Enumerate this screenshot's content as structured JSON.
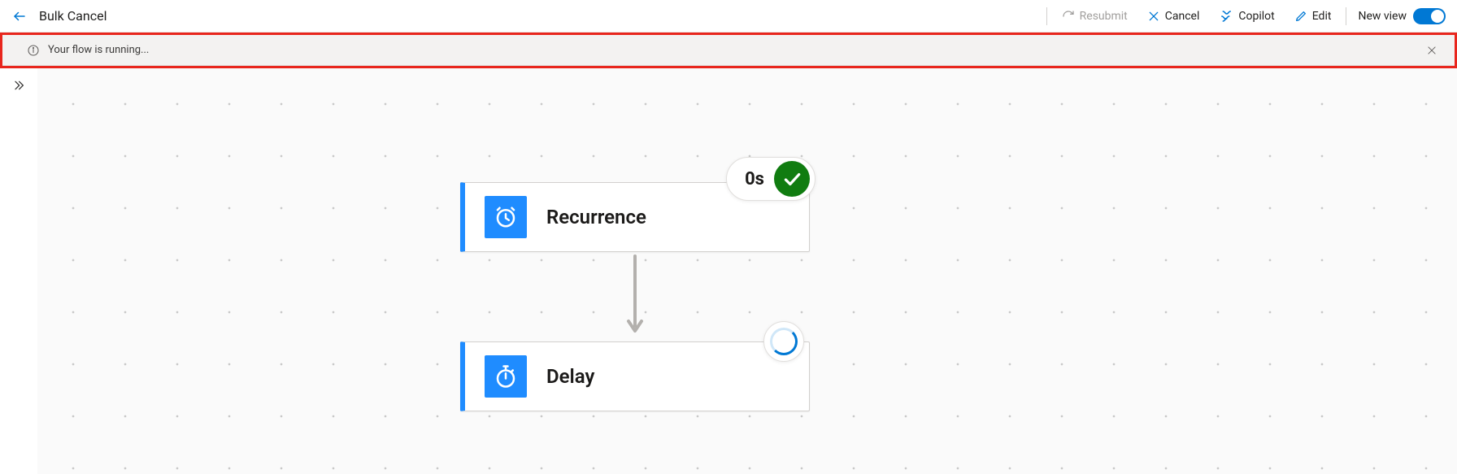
{
  "header": {
    "title": "Bulk Cancel",
    "actions": {
      "resubmit": "Resubmit",
      "cancel": "Cancel",
      "copilot": "Copilot",
      "edit": "Edit",
      "newview": "New view"
    }
  },
  "banner": {
    "message": "Your flow is running..."
  },
  "flow": {
    "nodes": {
      "recurrence": {
        "label": "Recurrence",
        "status_time": "0s",
        "status": "success"
      },
      "delay": {
        "label": "Delay",
        "status": "running"
      }
    }
  }
}
